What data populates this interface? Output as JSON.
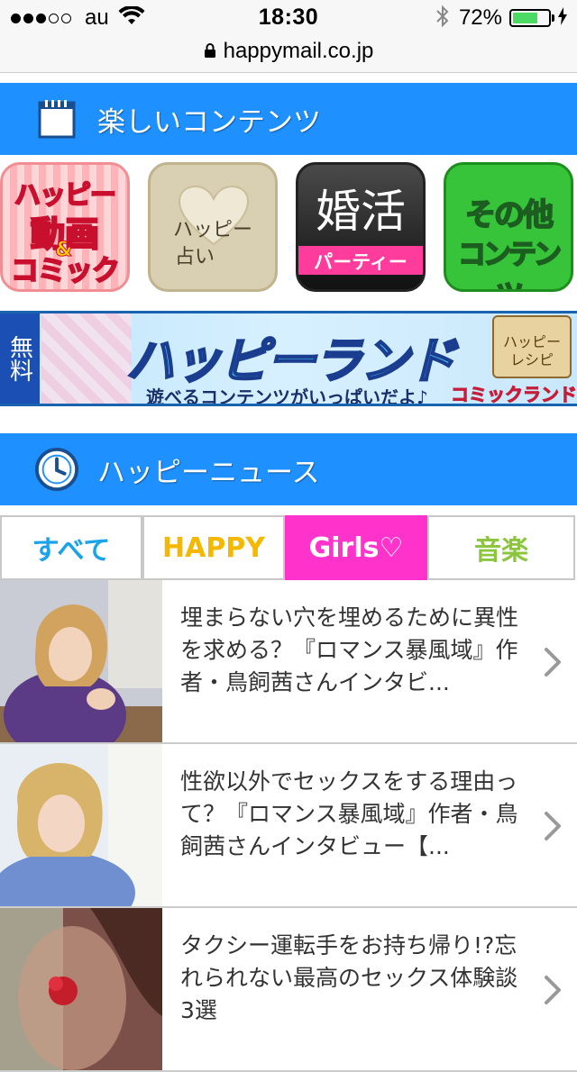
{
  "status_bar": {
    "signal_dots_filled": 3,
    "signal_dots_total": 5,
    "carrier": "au",
    "time": "18:30",
    "battery_percent": "72%",
    "battery_level": 0.72,
    "battery_color": "#4cd964"
  },
  "url_bar": {
    "domain": "happymail.co.jp"
  },
  "contents_section": {
    "title": "楽しいコンテンツ",
    "header_color": "#1e90ff",
    "icons": [
      {
        "lines": [
          "ハッピー",
          "動画",
          "コミック"
        ],
        "ampersand": "&"
      },
      {
        "lines": [
          "ハッピー",
          "占い"
        ]
      },
      {
        "lines": [
          "婚活",
          "パーティー"
        ]
      },
      {
        "lines": [
          "その他",
          "コンテンツ"
        ]
      }
    ]
  },
  "banner": {
    "badge": "無料",
    "title": "ハッピーランド",
    "subtitle": "遊べるコンテンツがいっぱいだよ♪",
    "comic_label": "コミックランド",
    "recipe_label": [
      "ハッピー",
      "レシピ"
    ]
  },
  "news_section": {
    "title": "ハッピーニュース",
    "tabs": [
      {
        "label": "すべて",
        "color": "#1aa3e8"
      },
      {
        "label": "HAPPY",
        "color": "#f5b800"
      },
      {
        "label": "Girls♡",
        "color": "#ffffff"
      },
      {
        "label": "音楽",
        "color": "#8cc63f"
      }
    ],
    "articles": [
      {
        "title": "埋まらない穴を埋めるために異性を求める？『ロマンス暴風域』作者・鳥飼茜さんインタビ..."
      },
      {
        "title": "性欲以外でセックスをする理由って？『ロマンス暴風域』作者・鳥飼茜さんインタビュー【..."
      },
      {
        "title": "タクシー運転手をお持ち帰り!?忘れられない最高のセックス体験談3選"
      }
    ]
  }
}
